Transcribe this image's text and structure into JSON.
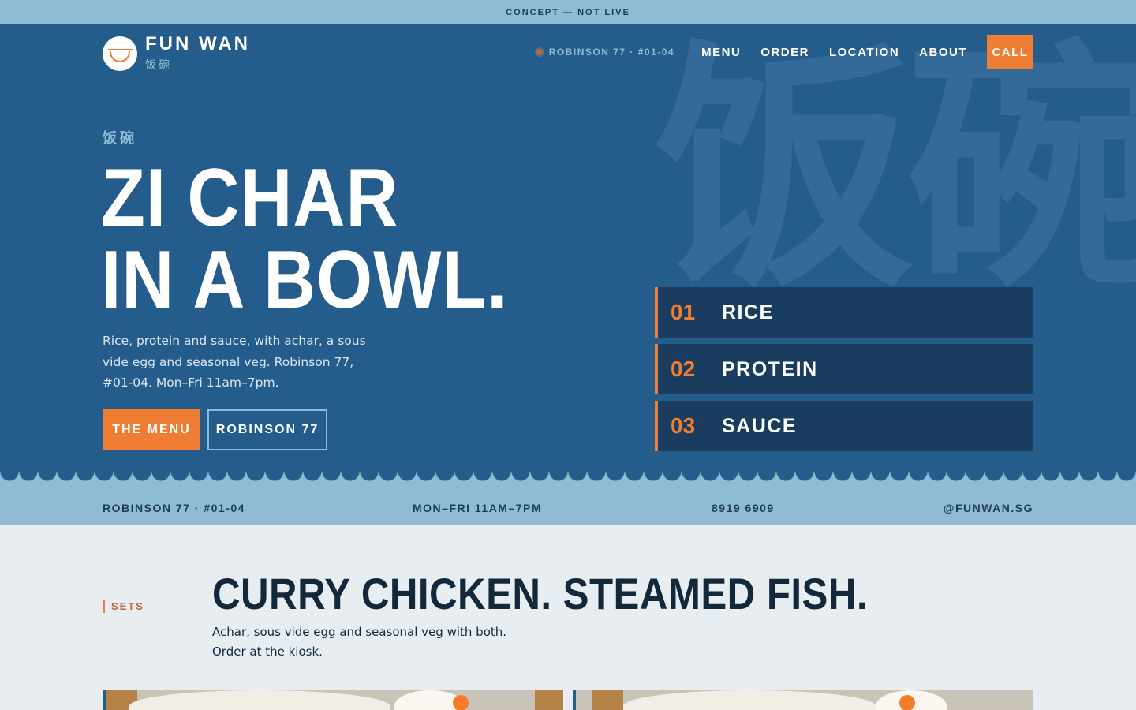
{
  "banner": {
    "text": "CONCEPT — NOT LIVE"
  },
  "brand": {
    "name": "FUN WAN",
    "name_cn": "饭碗"
  },
  "nav": {
    "location": "ROBINSON 77 · #01-04",
    "links": [
      "MENU",
      "ORDER",
      "LOCATION",
      "ABOUT"
    ],
    "call": "CALL"
  },
  "hero": {
    "eyebrow": "饭碗",
    "headline_line1": "ZI CHAR",
    "headline_line2": "IN A BOWL.",
    "lede": "Rice, protein and sauce, with achar, a sous vide egg and seasonal veg. Robinson 77, #01-04. Mon–Fri 11am–7pm.",
    "primary_button": "THE MENU",
    "secondary_button": "ROBINSON 77",
    "background_glyph": "饭碗",
    "steps": [
      {
        "num": "01",
        "label": "RICE"
      },
      {
        "num": "02",
        "label": "PROTEIN"
      },
      {
        "num": "03",
        "label": "SAUCE"
      }
    ]
  },
  "info": {
    "address": "ROBINSON 77 · #01-04",
    "hours": "MON–FRI 11AM–7PM",
    "phone": "8919 6909",
    "social": "@FUNWAN.SG"
  },
  "sets": {
    "tag": "SETS",
    "title": "CURRY CHICKEN. STEAMED FISH.",
    "description": "Achar, sous vide egg and seasonal veg with both. Order at the kiosk."
  },
  "colors": {
    "primary": "#245d8c",
    "accent": "#ef7d33",
    "light": "#8fbcd4",
    "dark": "#1a3c5e",
    "page": "#e8edf1"
  }
}
